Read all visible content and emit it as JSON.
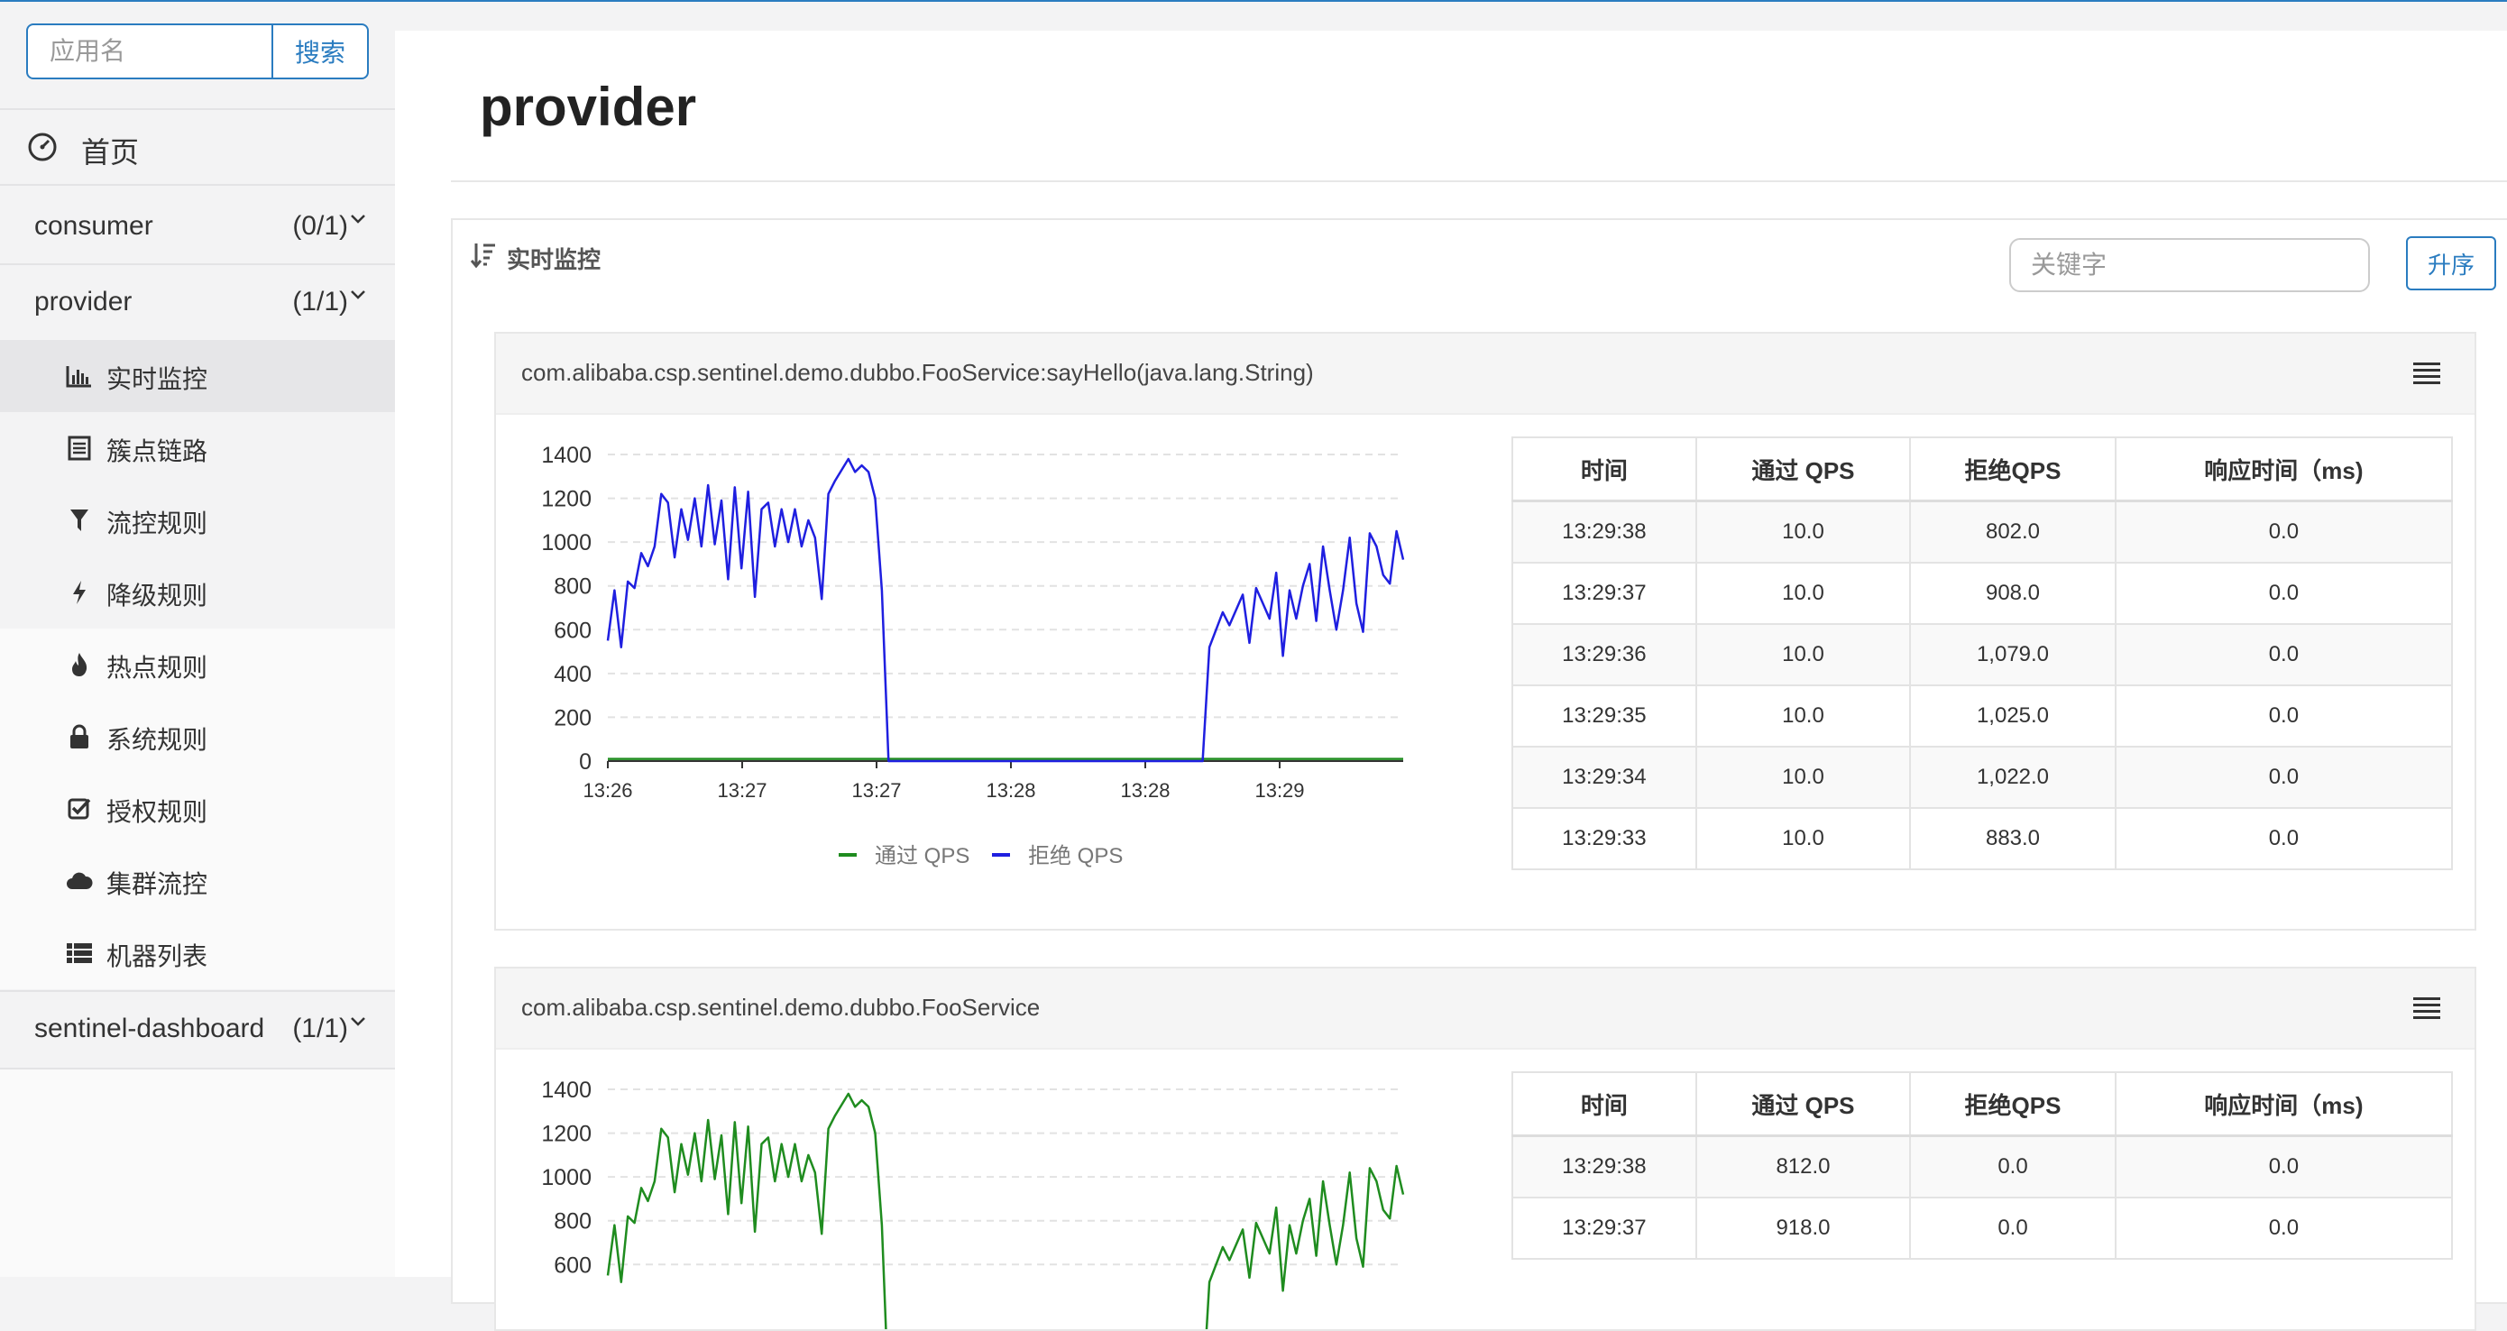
{
  "search": {
    "placeholder": "应用名",
    "button": "搜索"
  },
  "nav": {
    "home": "首页",
    "apps": [
      {
        "name": "consumer",
        "count": "(0/1)"
      },
      {
        "name": "provider",
        "count": "(1/1)"
      },
      {
        "name": "sentinel-dashboard",
        "count": "(1/1)"
      }
    ],
    "submenu": [
      {
        "label": "实时监控",
        "icon": "bar-chart-icon"
      },
      {
        "label": "簇点链路",
        "icon": "list-alt-icon"
      },
      {
        "label": "流控规则",
        "icon": "filter-icon"
      },
      {
        "label": "降级规则",
        "icon": "flash-icon"
      },
      {
        "label": "热点规则",
        "icon": "fire-icon"
      },
      {
        "label": "系统规则",
        "icon": "lock-icon"
      },
      {
        "label": "授权规则",
        "icon": "check-icon"
      },
      {
        "label": "集群流控",
        "icon": "cloud-icon"
      },
      {
        "label": "机器列表",
        "icon": "th-list-icon"
      }
    ]
  },
  "page": {
    "title": "provider",
    "section_title": "实时监控",
    "keyword_placeholder": "关键字",
    "sort_button": "升序"
  },
  "colors": {
    "accent": "#2a7cc0",
    "pass": "#1f8c1f",
    "block": "#1f1fe0"
  },
  "cards": [
    {
      "title": "com.alibaba.csp.sentinel.demo.dubbo.FooService:sayHello(java.lang.String)",
      "table": {
        "headers": [
          "时间",
          "通过 QPS",
          "拒绝QPS",
          "响应时间（ms)"
        ],
        "rows": [
          [
            "13:29:38",
            "10.0",
            "802.0",
            "0.0"
          ],
          [
            "13:29:37",
            "10.0",
            "908.0",
            "0.0"
          ],
          [
            "13:29:36",
            "10.0",
            "1,079.0",
            "0.0"
          ],
          [
            "13:29:35",
            "10.0",
            "1,025.0",
            "0.0"
          ],
          [
            "13:29:34",
            "10.0",
            "1,022.0",
            "0.0"
          ],
          [
            "13:29:33",
            "10.0",
            "883.0",
            "0.0"
          ]
        ]
      }
    },
    {
      "title": "com.alibaba.csp.sentinel.demo.dubbo.FooService",
      "table": {
        "headers": [
          "时间",
          "通过 QPS",
          "拒绝QPS",
          "响应时间（ms)"
        ],
        "rows": [
          [
            "13:29:38",
            "812.0",
            "0.0",
            "0.0"
          ],
          [
            "13:29:37",
            "918.0",
            "0.0",
            "0.0"
          ]
        ]
      }
    }
  ],
  "chart_data": [
    {
      "type": "line",
      "x_tick_labels": [
        "13:26",
        "13:27",
        "13:27",
        "13:28",
        "13:28",
        "13:29"
      ],
      "ylim": [
        0,
        1400
      ],
      "y_ticks": [
        0,
        200,
        400,
        600,
        800,
        1000,
        1200,
        1400
      ],
      "legend": "bottom",
      "grid": "horizontal dashed",
      "series": [
        {
          "name": "通过 QPS",
          "color": "#1f8c1f",
          "values": [
            10,
            10,
            10,
            10,
            10,
            10,
            10,
            10,
            10,
            10,
            10,
            10,
            10,
            10,
            10,
            10,
            10,
            10,
            10,
            10,
            10,
            10,
            10,
            10,
            10,
            10,
            10,
            10,
            10,
            10,
            10,
            10,
            10,
            10,
            10,
            10,
            10,
            10,
            10,
            10,
            10,
            10,
            10,
            10,
            10,
            10,
            10,
            10,
            10,
            10,
            10,
            10,
            10,
            10,
            10,
            10,
            10,
            10,
            10,
            10,
            10,
            10,
            10,
            10,
            10,
            10,
            10,
            10,
            10,
            10,
            10,
            10,
            10,
            10,
            10,
            10,
            10,
            10,
            10,
            10,
            10,
            10,
            10,
            10,
            10,
            10,
            10,
            10,
            10,
            10,
            10,
            10,
            10,
            10,
            10,
            10,
            10,
            10,
            10,
            10,
            10,
            10,
            10,
            10,
            10,
            10,
            10,
            10,
            10,
            10,
            10,
            10,
            10,
            10,
            10,
            10,
            10,
            10,
            10,
            10
          ]
        },
        {
          "name": "拒绝 QPS",
          "color": "#1f1fe0",
          "values": [
            550,
            780,
            520,
            820,
            790,
            950,
            890,
            980,
            1220,
            1180,
            930,
            1150,
            1010,
            1200,
            980,
            1260,
            990,
            1190,
            830,
            1250,
            880,
            1230,
            750,
            1150,
            1180,
            980,
            1150,
            1000,
            1150,
            980,
            1100,
            1020,
            740,
            1220,
            1280,
            1330,
            1380,
            1320,
            1350,
            1320,
            1200,
            780,
            0,
            0,
            0,
            0,
            0,
            0,
            0,
            0,
            0,
            0,
            0,
            0,
            0,
            0,
            0,
            0,
            0,
            0,
            0,
            0,
            0,
            0,
            0,
            0,
            0,
            0,
            0,
            0,
            0,
            0,
            0,
            0,
            0,
            0,
            0,
            0,
            0,
            0,
            0,
            0,
            0,
            0,
            0,
            0,
            0,
            0,
            0,
            0,
            520,
            600,
            680,
            620,
            690,
            760,
            540,
            790,
            720,
            650,
            860,
            480,
            780,
            650,
            800,
            900,
            640,
            980,
            780,
            600,
            780,
            1020,
            720,
            590,
            1040,
            980,
            850,
            810,
            1050,
            920
          ]
        }
      ]
    },
    {
      "type": "line",
      "x_tick_labels": [],
      "ylim": [
        0,
        1400
      ],
      "y_ticks": [
        600,
        800,
        1000,
        1200,
        1400
      ],
      "series": [
        {
          "name": "通过 QPS",
          "color": "#1f8c1f",
          "values": [
            550,
            780,
            520,
            820,
            790,
            950,
            890,
            980,
            1220,
            1180,
            930,
            1150,
            1010,
            1200,
            980,
            1260,
            990,
            1190,
            830,
            1250,
            880,
            1230,
            750,
            1150,
            1180,
            980,
            1150,
            1000,
            1150,
            980,
            1100,
            1020,
            740,
            1220,
            1280,
            1330,
            1380,
            1320,
            1350,
            1320,
            1200,
            780,
            0,
            0,
            0,
            0,
            0,
            0,
            0,
            0,
            0,
            0,
            0,
            0,
            0,
            0,
            0,
            0,
            0,
            0,
            0,
            0,
            0,
            0,
            0,
            0,
            0,
            0,
            0,
            0,
            0,
            0,
            0,
            0,
            0,
            0,
            0,
            0,
            0,
            0,
            0,
            0,
            0,
            0,
            0,
            0,
            0,
            0,
            0,
            0,
            520,
            600,
            680,
            620,
            690,
            760,
            540,
            790,
            720,
            650,
            860,
            480,
            780,
            650,
            800,
            900,
            640,
            980,
            780,
            600,
            780,
            1020,
            720,
            590,
            1040,
            980,
            850,
            810,
            1050,
            920
          ]
        }
      ]
    }
  ]
}
